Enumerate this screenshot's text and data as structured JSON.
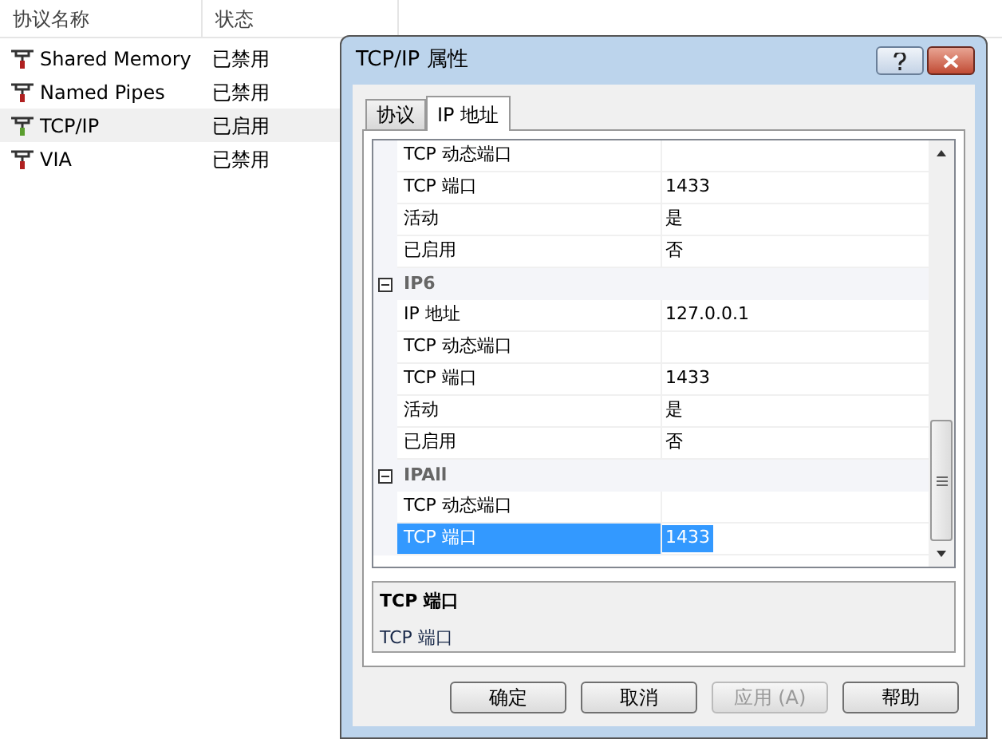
{
  "protocol_list": {
    "columns": [
      "协议名称",
      "状态"
    ],
    "rows": [
      {
        "name": "Shared Memory",
        "status": "已禁用",
        "enabled": false,
        "selected": false
      },
      {
        "name": "Named Pipes",
        "status": "已禁用",
        "enabled": false,
        "selected": false
      },
      {
        "name": "TCP/IP",
        "status": "已启用",
        "enabled": true,
        "selected": true
      },
      {
        "name": "VIA",
        "status": "已禁用",
        "enabled": false,
        "selected": false
      }
    ]
  },
  "dialog": {
    "title": "TCP/IP 属性",
    "tabs": [
      {
        "label": "协议",
        "selected": false
      },
      {
        "label": "IP 地址",
        "selected": true
      }
    ],
    "properties": [
      {
        "kind": "property",
        "name": "TCP 动态端口",
        "selected": false
      },
      {
        "kind": "property",
        "name": "TCP 端口",
        "value": "1433",
        "selected": false
      },
      {
        "kind": "property",
        "name": "活动",
        "value": "是",
        "selected": false
      },
      {
        "kind": "property",
        "name": "已启用",
        "value": "否",
        "selected": false
      },
      {
        "kind": "group",
        "name": "IP6",
        "expanded": true
      },
      {
        "kind": "property",
        "name": "IP 地址",
        "value": "127.0.0.1",
        "selected": false
      },
      {
        "kind": "property",
        "name": "TCP 动态端口",
        "selected": false
      },
      {
        "kind": "property",
        "name": "TCP 端口",
        "value": "1433",
        "selected": false
      },
      {
        "kind": "property",
        "name": "活动",
        "value": "是",
        "selected": false
      },
      {
        "kind": "property",
        "name": "已启用",
        "value": "否",
        "selected": false
      },
      {
        "kind": "group",
        "name": "IPAll",
        "expanded": true
      },
      {
        "kind": "property",
        "name": "TCP 动态端口",
        "selected": false
      },
      {
        "kind": "property",
        "name": "TCP 端口",
        "value": "1433",
        "selected": true
      }
    ],
    "description": {
      "title": "TCP 端口",
      "text": "TCP 端口"
    },
    "buttons": [
      {
        "label": "确定",
        "disabled": false
      },
      {
        "label": "取消",
        "disabled": false
      },
      {
        "label": "应用 (A)",
        "disabled": true
      },
      {
        "label": "帮助",
        "disabled": false
      }
    ]
  }
}
